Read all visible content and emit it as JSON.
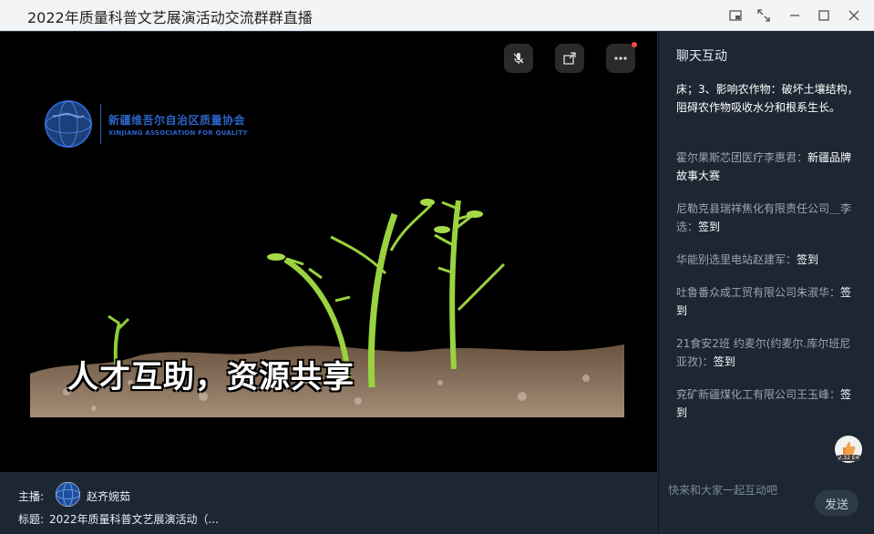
{
  "window": {
    "title": "2022年质量科普文艺展演活动交流群群直播"
  },
  "video": {
    "logo_cn": "新疆维吾尔自治区质量协会",
    "logo_en": "XINJIANG ASSOCIATION FOR QUALITY",
    "logo_mark": "XJAQ",
    "subtitle": "人才互助，资源共享"
  },
  "footer": {
    "host_label": "主播:",
    "host_name": "赵齐婉茹",
    "title_label": "标题:",
    "title_value": "2022年质量科普文艺展演活动（..."
  },
  "chat": {
    "header": "聊天互动",
    "messages": [
      {
        "sender": "",
        "content": "床；3、影响农作物：破坏土壤结构，阻碍农作物吸收水分和根系生长。"
      },
      {
        "sender": "霍尔果斯芯团医疗李惠君：",
        "content": "新疆品牌故事大赛"
      },
      {
        "sender": "尼勒克县瑞祥焦化有限责任公司＿李选：",
        "content": "签到"
      },
      {
        "sender": "华能别选里电站赵建军：",
        "content": "签到"
      },
      {
        "sender": "吐鲁番众成工贸有限公司朱淑华：",
        "content": "签到"
      },
      {
        "sender": "21食安2班 约麦尔(约麦尔.库尔班尼亚孜)：",
        "content": "签到"
      },
      {
        "sender": "兖矿新疆煤化工有限公司王玉峰：",
        "content": "签到"
      }
    ],
    "like_count": "2.32 E4"
  },
  "composer": {
    "placeholder": "快来和大家一起互动吧",
    "send_label": "发送"
  }
}
